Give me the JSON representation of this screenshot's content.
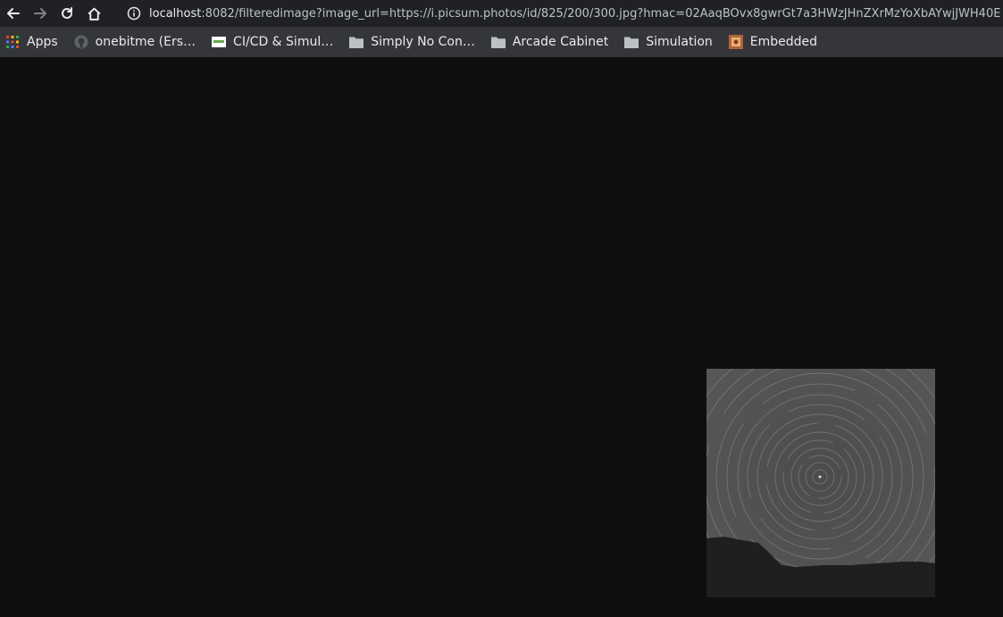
{
  "browser": {
    "url_host": "localhost",
    "url_rest": ":8082/filteredimage?image_url=https://i.picsum.photos/id/825/200/300.jpg?hmac=02AaqBOvx8gwrGt7a3HWzJHnZXrMzYoXbAYwjJWH40E"
  },
  "bookmarks": [
    {
      "label": "Apps",
      "icon": "apps-grid-icon"
    },
    {
      "label": "onebitme (Ers…",
      "icon": "github-icon"
    },
    {
      "label": "CI/CD & Simul…",
      "icon": "site-favicon-icon"
    },
    {
      "label": "Simply No Con…",
      "icon": "folder-icon"
    },
    {
      "label": "Arcade Cabinet",
      "icon": "folder-icon"
    },
    {
      "label": "Simulation",
      "icon": "folder-icon"
    },
    {
      "label": "Embedded",
      "icon": "embedded-favicon-icon"
    }
  ],
  "colors": {
    "page_background": "#0e0e0e",
    "toolbar": "#202124",
    "bookmarks_bar": "#35363a"
  }
}
